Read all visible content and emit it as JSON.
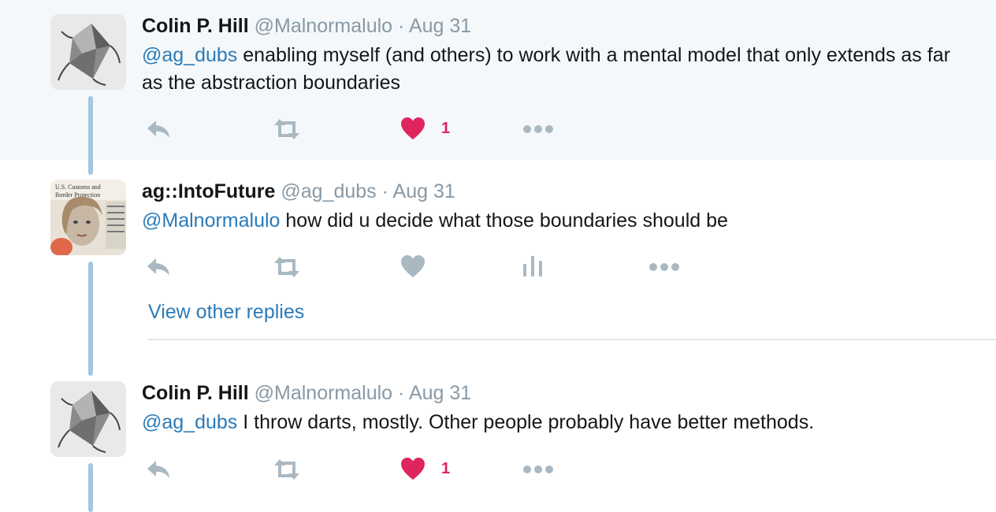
{
  "tweets": [
    {
      "name": "Colin P. Hill",
      "handle": "@Malnormalulo",
      "separator": "·",
      "date": "Aug 31",
      "mention": "@ag_dubs",
      "body": " enabling myself (and others) to work with a mental model that only extends as far as the abstraction boundaries",
      "like_count": "1",
      "liked": true
    },
    {
      "name": "ag::IntoFuture",
      "handle": "@ag_dubs",
      "separator": "·",
      "date": "Aug 31",
      "mention": "@Malnormalulo",
      "body": " how did u decide what those boundaries should be",
      "liked": false
    },
    {
      "name": "Colin P. Hill",
      "handle": "@Malnormalulo",
      "separator": "·",
      "date": "Aug 31",
      "mention": "@ag_dubs",
      "body": " I throw darts, mostly. Other people probably have better methods.",
      "like_count": "1",
      "liked": true
    }
  ],
  "view_other_replies": "View other replies",
  "colors": {
    "like_active": "#e0245e",
    "icon_gray": "#aab8c2",
    "link_blue": "#2b7bb9",
    "thread_line": "#a5c6df",
    "highlight_bg": "#f5f8fa"
  },
  "icons": [
    "reply-icon",
    "retweet-icon",
    "heart-icon",
    "analytics-icon",
    "more-icon"
  ]
}
